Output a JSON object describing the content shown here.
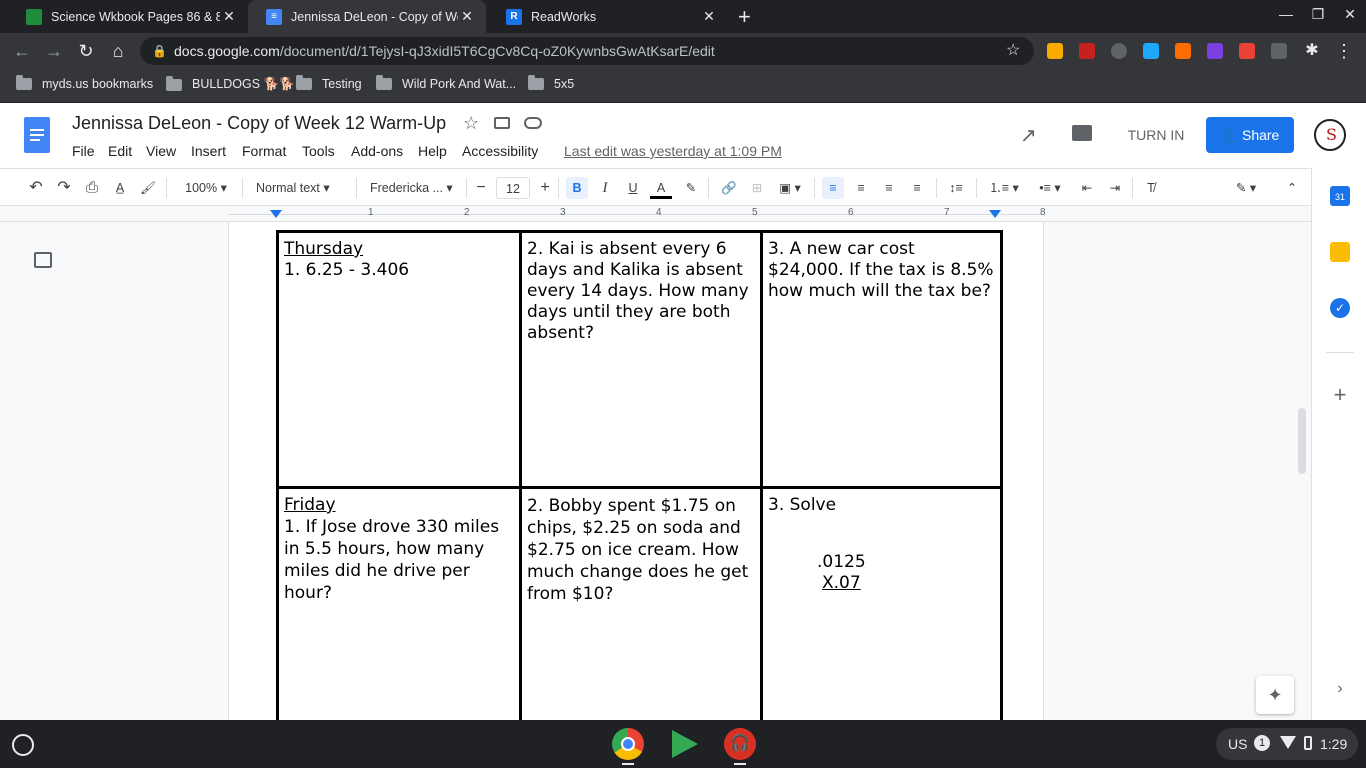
{
  "browser": {
    "tabs": [
      {
        "title": "Science Wkbook Pages 86 & 87",
        "icon": "google-classroom-icon",
        "active": false
      },
      {
        "title": "Jennissa DeLeon - Copy of Week 12 Warm-Up",
        "icon": "google-docs-icon",
        "active": true
      },
      {
        "title": "ReadWorks",
        "icon": "readworks-icon",
        "active": false
      }
    ],
    "new_tab": "+",
    "url_host": "docs.google.com",
    "url_path": "/document/d/1TejysI-qJ3xidI5T6CgCv8Cq-oZ0KywnbsGwAtKsarE/edit",
    "bookmarks": [
      {
        "label": "myds.us bookmarks",
        "icon": "bookmarks-folder-icon"
      },
      {
        "label": "BULLDOGS 🐕🐕",
        "icon": "folder-icon"
      },
      {
        "label": "Testing",
        "icon": "folder-icon"
      },
      {
        "label": "Wild Pork And Wat...",
        "icon": "folder-icon"
      },
      {
        "label": "5x5",
        "icon": "folder-icon"
      }
    ]
  },
  "docs": {
    "title": "Jennissa DeLeon - Copy of Week 12  Warm-Up",
    "menu": [
      "File",
      "Edit",
      "View",
      "Insert",
      "Format",
      "Tools",
      "Add-ons",
      "Help",
      "Accessibility"
    ],
    "last_edit": "Last edit was yesterday at 1:09 PM",
    "turn_in": "TURN IN",
    "share": "Share",
    "toolbar": {
      "zoom": "100%",
      "style": "Normal text",
      "font": "Fredericka ...",
      "font_size": "12"
    },
    "ruler_numbers": [
      "1",
      "2",
      "3",
      "4",
      "5",
      "6",
      "7",
      "8"
    ]
  },
  "table": {
    "rows": [
      {
        "day": "Thursday",
        "c1": "1. 6.25 - 3.406",
        "c2": "2.  Kai is absent every 6 days and Kalika is absent every 14 days. How many days until they are both absent?",
        "c3": "3. A new car cost $24,000. If the tax is 8.5% how much will the tax be?"
      },
      {
        "day": "Friday",
        "c1": "1. If Jose drove 330 miles in 5.5 hours, how many miles did he drive per hour?",
        "c2": "2. Bobby spent $1.75 on chips, $2.25 on soda and $2.75 on ice cream.  How much change does he get from $10?",
        "c3": "3. Solve",
        "c3_line1": ".0125",
        "c3_line2": "X.07"
      }
    ]
  },
  "system": {
    "locale": "US",
    "notifications": "1",
    "time": "1:29"
  }
}
